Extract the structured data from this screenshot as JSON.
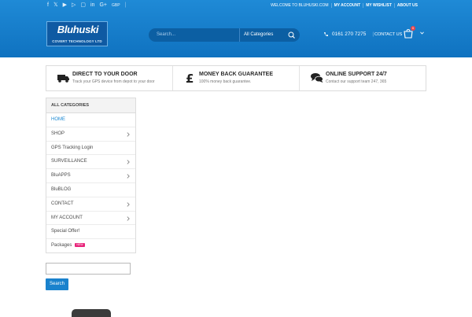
{
  "header": {
    "currency": "GBP",
    "top_links": [
      "WELCOME TO BLUHUSKI.COM",
      "MY ACCOUNT",
      "MY WISHLIST",
      "ABOUT US"
    ],
    "logo_text": "Bluhuski",
    "logo_tagline": "COVERT TECHNOLOGY LTD",
    "search_placeholder": "Search...",
    "search_category": "All Categories",
    "phone": "0161 270 7275",
    "contact_label": "CONTACT US",
    "cart_count": "0",
    "colors": {
      "brand": "#1a82cd",
      "header_bg": "#1a82cd"
    }
  },
  "features": [
    {
      "title": "DIRECT TO YOUR DOOR",
      "subtitle": "Track your GPS device from depot to your door",
      "icon": "truck-icon"
    },
    {
      "title": "MONEY BACK GUARANTEE",
      "subtitle": "100% money back guarantee.",
      "icon": "pound-icon"
    },
    {
      "title": "ONLINE SUPPORT 24/7",
      "subtitle": "Contact our support team 247, 365",
      "icon": "chat-icon"
    }
  ],
  "sidebar": {
    "heading": "ALL CATEGORIES",
    "items": [
      {
        "label": "HOME",
        "arrow": false,
        "active": true
      },
      {
        "label": "SHOP",
        "arrow": true
      },
      {
        "label": "GPS Tracking Login",
        "arrow": false
      },
      {
        "label": "SURVEILLANCE",
        "arrow": true
      },
      {
        "label": "BluAPPS",
        "arrow": true
      },
      {
        "label": "BluBLOG",
        "arrow": false
      },
      {
        "label": "CONTACT",
        "arrow": true
      },
      {
        "label": "MY ACCOUNT",
        "arrow": true
      },
      {
        "label": "Special Offer!",
        "arrow": false
      },
      {
        "label": "Packages",
        "arrow": false,
        "tag": "NEW"
      }
    ]
  },
  "search_widget": {
    "button_label": "Search",
    "value": ""
  }
}
